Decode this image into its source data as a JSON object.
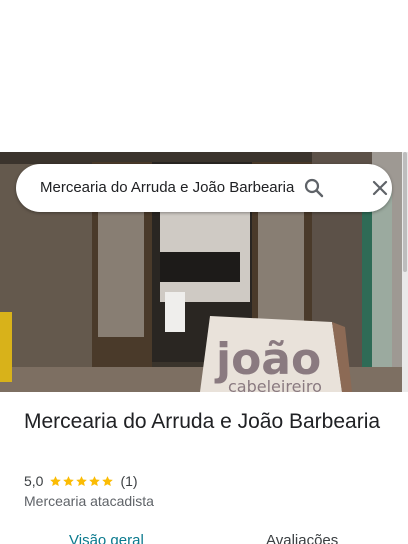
{
  "search": {
    "query": "Mercearia do Arruda e João Barbearia",
    "search_icon": "search-icon",
    "close_icon": "close-icon"
  },
  "hero": {
    "sign_text_line1": "joão",
    "sign_text_line2": "cabeleireiro"
  },
  "place": {
    "title": "Mercearia do Arruda e João Barbearia",
    "rating": "5,0",
    "stars": 5,
    "review_count": "(1)",
    "category": "Mercearia atacadista"
  },
  "tabs": [
    {
      "label": "Visão geral",
      "active": true
    },
    {
      "label": "Avaliações",
      "active": false
    }
  ],
  "colors": {
    "star": "#fbbc04",
    "active_tab": "#0b7a8e",
    "text_primary": "#202124",
    "text_secondary": "#5f6368"
  }
}
